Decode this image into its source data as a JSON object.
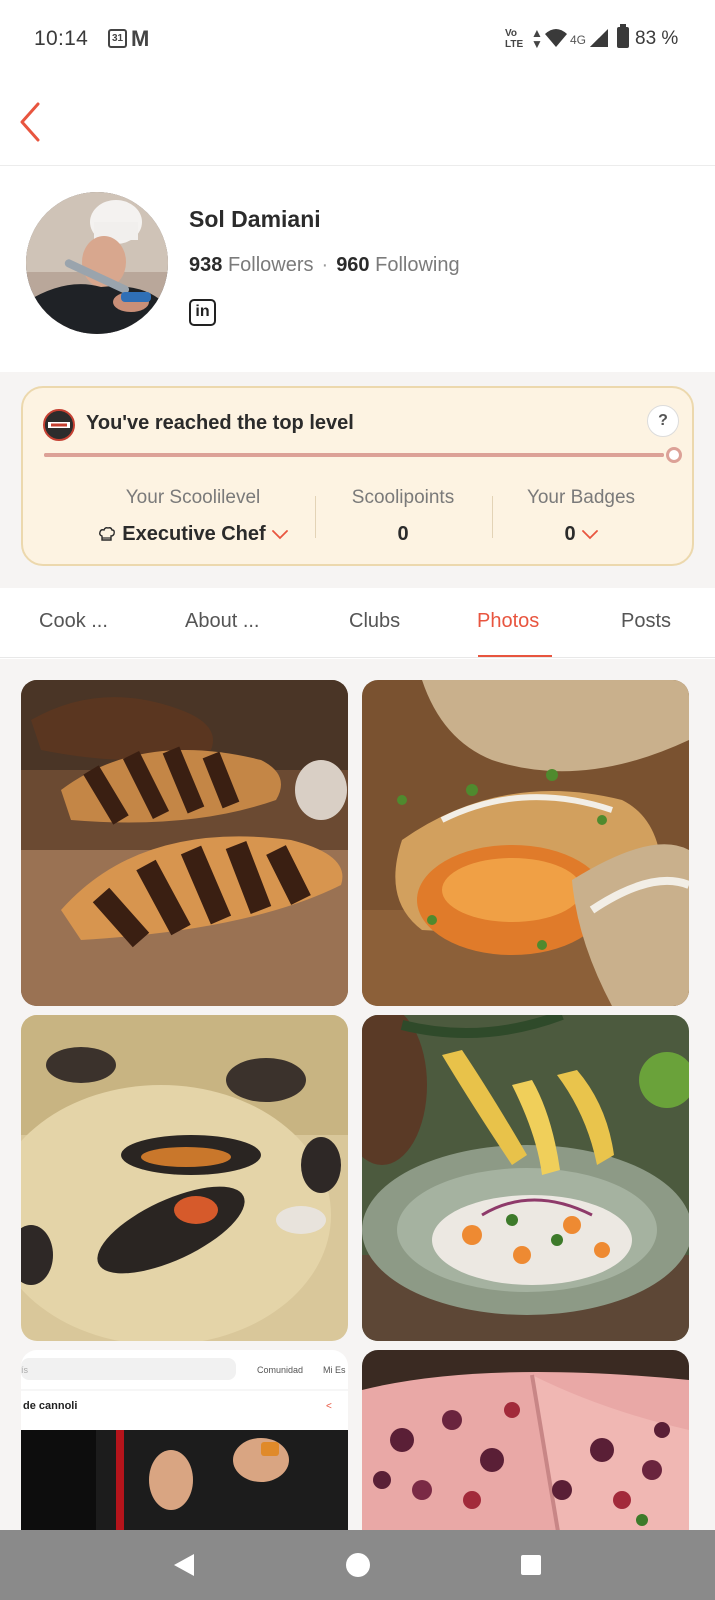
{
  "status_bar": {
    "time": "10:14",
    "calendar_day": "31",
    "carrier_icon": "M",
    "network_volte_top": "Vo",
    "network_volte_bottom": "LTE",
    "network_type": "4G",
    "battery_percent": "83 %"
  },
  "header": {
    "back_icon": "chevron-left-icon"
  },
  "profile": {
    "name": "Sol Damiani",
    "followers_count": "938",
    "followers_label": "Followers",
    "separator": "·",
    "following_count": "960",
    "following_label": "Following",
    "linkedin_glyph": "in"
  },
  "level_card": {
    "title": "You've reached the top level",
    "help_label": "?",
    "progress": 1.0,
    "scoolilevel_label": "Your Scoolilevel",
    "scoolilevel_value": "Executive Chef",
    "scoolipoints_label": "Scoolipoints",
    "scoolipoints_value": "0",
    "badges_label": "Your Badges",
    "badges_value": "0"
  },
  "tabs": [
    {
      "label": "Cook ...",
      "active": false
    },
    {
      "label": "About ...",
      "active": false
    },
    {
      "label": "Clubs",
      "active": false
    },
    {
      "label": "Photos",
      "active": true
    },
    {
      "label": "Posts",
      "active": false
    }
  ],
  "photos": [
    {
      "subject": "chocolate croissants"
    },
    {
      "subject": "vegetable strudel rolls"
    },
    {
      "subject": "seafood rice with mussels"
    },
    {
      "subject": "ceviche with plantain chips"
    },
    {
      "subject": "cannoli video screenshot",
      "ui_search_tab": "Comunidad",
      "ui_tab2": "Mi Es",
      "ui_title": "de cannoli"
    },
    {
      "subject": "berry focaccia"
    }
  ],
  "colors": {
    "accent": "#e8553f",
    "level_card_bg": "#fdf3e2",
    "level_card_border": "#ecd8ad",
    "progress": "#dca197",
    "navbar": "#8a8a8a"
  }
}
